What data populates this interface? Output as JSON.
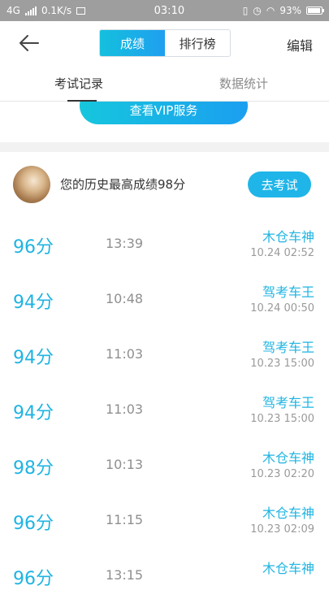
{
  "status_bar": {
    "network": "4G",
    "speed": "0.1K/s",
    "time": "03:10",
    "battery": "93%"
  },
  "header": {
    "back_icon": "back-arrow-icon",
    "segments": [
      "成绩",
      "排行榜"
    ],
    "active_segment": "成绩",
    "edit_label": "编辑"
  },
  "tabs": [
    {
      "label": "考试记录",
      "active": true
    },
    {
      "label": "数据统计",
      "active": false
    }
  ],
  "vip_button": "查看VIP服务",
  "best": {
    "text": "您的历史最高成绩98分",
    "exam_button": "去考试"
  },
  "records": [
    {
      "score": "96分",
      "duration": "13:39",
      "rank": "木仓车神",
      "date": "10.24  02:52"
    },
    {
      "score": "94分",
      "duration": "10:48",
      "rank": "驾考车王",
      "date": "10.24  00:50"
    },
    {
      "score": "94分",
      "duration": "11:03",
      "rank": "驾考车王",
      "date": "10.23  15:00"
    },
    {
      "score": "94分",
      "duration": "11:03",
      "rank": "驾考车王",
      "date": "10.23  15:00"
    },
    {
      "score": "98分",
      "duration": "10:13",
      "rank": "木仓车神",
      "date": "10.23  02:20"
    },
    {
      "score": "96分",
      "duration": "11:15",
      "rank": "木仓车神",
      "date": "10.23  02:09"
    },
    {
      "score": "96分",
      "duration": "13:15",
      "rank": "木仓车神",
      "date": ""
    }
  ],
  "colors": {
    "accent": "#1fb4e2",
    "status_bar": "#9e9e9e"
  }
}
